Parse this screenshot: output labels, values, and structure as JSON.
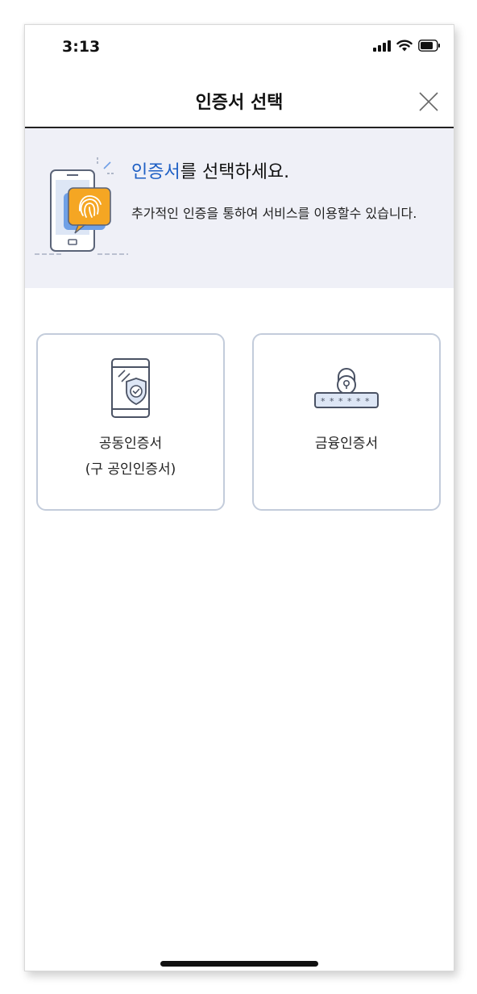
{
  "status_bar": {
    "time": "3:13"
  },
  "header": {
    "title": "인증서 선택"
  },
  "banner": {
    "title_accent": "인증서",
    "title_rest": "를 선택하세요.",
    "description": "추가적인 인증을 통하여 서비스를 이용할수 있습니다."
  },
  "cards": [
    {
      "line1": "공동인증서",
      "line2": "(구 공인인증서)",
      "icon": "shield-phone-icon"
    },
    {
      "line1": "금융인증서",
      "line2": "",
      "icon": "padlock-password-icon"
    }
  ],
  "colors": {
    "accent": "#1e5fc4",
    "banner_bg": "#eff0f7",
    "card_border": "#c3ccdb",
    "illustration_orange": "#f5a623"
  }
}
